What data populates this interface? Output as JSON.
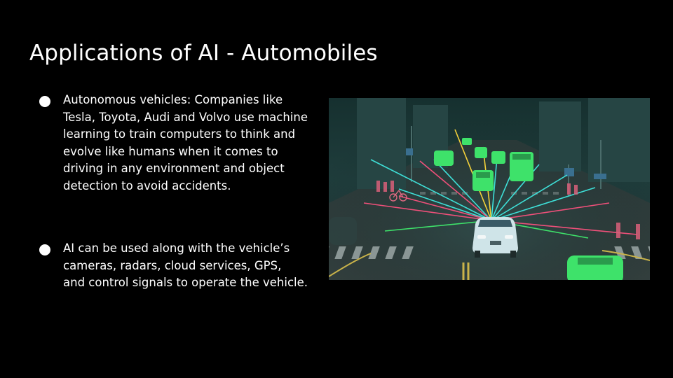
{
  "slide": {
    "title": "Applications of AI - Automobiles",
    "bullets": [
      {
        "lines": [
          "Autonomous vehicles: Companies like",
          "Tesla, Toyota, Audi and Volvo use machine",
          "learning to train computers to think and",
          "evolve like humans when it comes to",
          "driving in any environment and object",
          "detection to avoid accidents."
        ]
      },
      {
        "lines": [
          "AI can be used along with the vehicle’s",
          "cameras, radars, cloud services, GPS,",
          "and control signals to operate the vehicle."
        ]
      }
    ],
    "image": {
      "icon": "autonomous-car-sensor-illustration",
      "colors": {
        "background": "#1d3a3b",
        "road": "#2a3a3a",
        "highlight_green": "#3ee26a",
        "sensor_cyan": "#3ee0d8",
        "sensor_pink": "#f0507a",
        "sensor_yellow": "#f5d23a"
      }
    }
  }
}
